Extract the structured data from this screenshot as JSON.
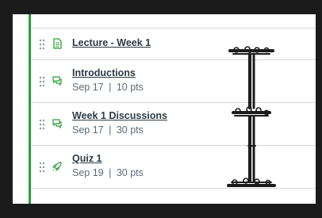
{
  "module_items": [
    {
      "title": "Lecture - Week 1",
      "due": "",
      "sep": "",
      "points": "",
      "icon": "page-icon"
    },
    {
      "title": "Introductions",
      "due": "Sep 17",
      "sep": "|",
      "points": "10 pts",
      "icon": "discussion-icon"
    },
    {
      "title": "Week 1 Discussions",
      "due": "Sep 17",
      "sep": "|",
      "points": "30 pts",
      "icon": "discussion-icon"
    },
    {
      "title": "Quiz 1",
      "due": "Sep 19",
      "sep": "|",
      "points": "30 pts",
      "icon": "quiz-rocket-icon"
    }
  ],
  "colors": {
    "accent_green": "#2aa038",
    "frame_bg": "#1b1b1b",
    "title_text": "#2d3b45",
    "meta_text": "#5c6b78"
  }
}
